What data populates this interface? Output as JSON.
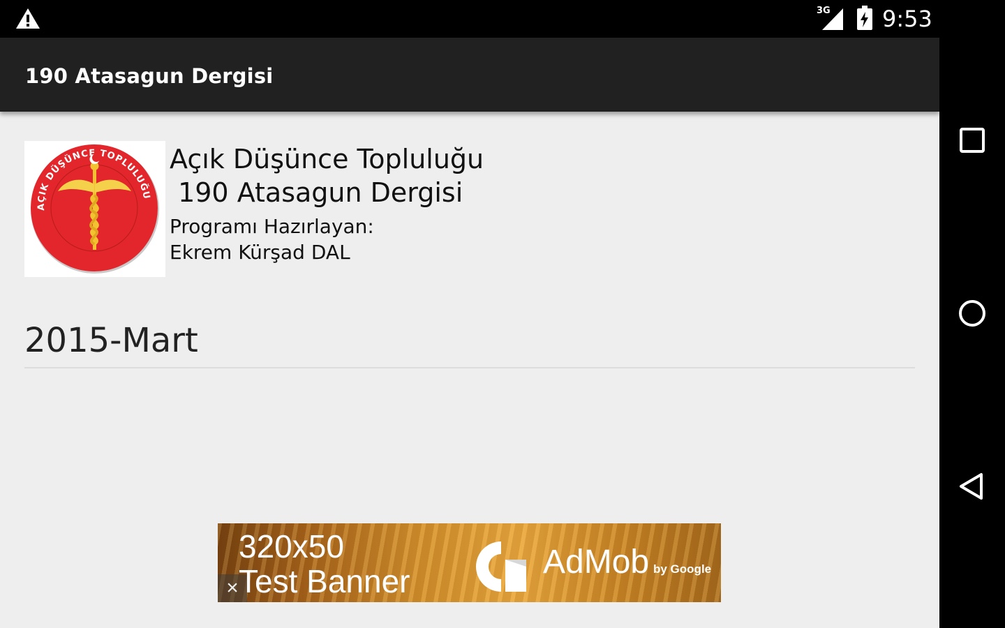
{
  "status_bar": {
    "network_type": "3G",
    "time": "9:53",
    "icons": [
      "warning-icon",
      "signal-icon",
      "battery-icon"
    ]
  },
  "app_bar": {
    "title": "190 Atasagun Dergisi"
  },
  "header": {
    "org_name": "Açık Düşünce Topluluğu",
    "magazine_name": " 190 Atasagun Dergisi",
    "prepared_by_label": "Programı Hazırlayan:",
    "prepared_by_name": "Ekrem Kürşad DAL",
    "logo_ring_text": "AÇIK DÜŞÜNCE TOPLULUĞU",
    "logo_color": "#e3262b"
  },
  "issues": [
    {
      "label": "2015-Mart"
    }
  ],
  "ad": {
    "size_label": "320x50",
    "text": "Test Banner",
    "close": "×",
    "brand": "AdMob",
    "brand_sub": "by Google"
  },
  "nav": {
    "items": [
      "recents-icon",
      "home-icon",
      "back-icon"
    ]
  }
}
